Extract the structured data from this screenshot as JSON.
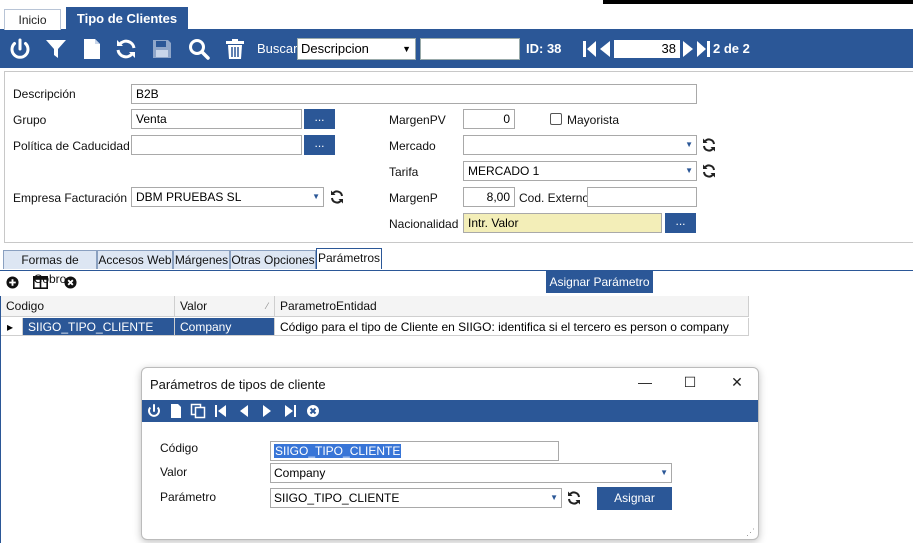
{
  "tabs": {
    "home": "Inicio",
    "active": "Tipo de Clientes"
  },
  "toolbar": {
    "search_label": "Buscar",
    "search_field": "Descripcion",
    "search_value": "",
    "id_label": "ID: 38",
    "record_value": "38",
    "record_count": "2 de 2"
  },
  "form": {
    "descripcion_label": "Descripción",
    "descripcion_value": "B2B",
    "grupo_label": "Grupo",
    "grupo_value": "Venta",
    "politica_label": "Política de Caducidad",
    "politica_value": "",
    "empresa_label": "Empresa Facturación",
    "empresa_value": "DBM PRUEBAS SL",
    "margenpv_label": "MargenPV",
    "margenpv_value": "0",
    "mayorista_label": "Mayorista",
    "mercado_label": "Mercado",
    "mercado_value": "",
    "tarifa_label": "Tarifa",
    "tarifa_value": "MERCADO 1",
    "margenp_label": "MargenP",
    "margenp_value": "8,00",
    "cod_externo_label": "Cod. Externo",
    "cod_externo_value": "",
    "nacionalidad_label": "Nacionalidad",
    "nacionalidad_value": "Intr. Valor",
    "dots": "..."
  },
  "subtabs": [
    "Formas de Cobro",
    "Accesos Web",
    "Márgenes",
    "Otras Opciones",
    "Parámetros"
  ],
  "grid": {
    "assign_button": "Asignar Parámetro",
    "columns": [
      "Codigo",
      "Valor",
      "ParametroEntidad"
    ],
    "rows": [
      {
        "codigo": "SIIGO_TIPO_CLIENTE",
        "valor": "Company",
        "entidad": "Código para el tipo de Cliente en SIIGO: identifica si el tercero es person o company"
      }
    ]
  },
  "dialog": {
    "title": "Parámetros de tipos de cliente",
    "codigo_label": "Código",
    "codigo_value": "SIIGO_TIPO_CLIENTE",
    "valor_label": "Valor",
    "valor_value": "Company",
    "parametro_label": "Parámetro",
    "parametro_value": "SIIGO_TIPO_CLIENTE",
    "assign_button": "Asignar"
  },
  "colors": {
    "accent": "#2b5797",
    "highlight_field": "#f3eeb8",
    "selection": "#3875d7"
  }
}
